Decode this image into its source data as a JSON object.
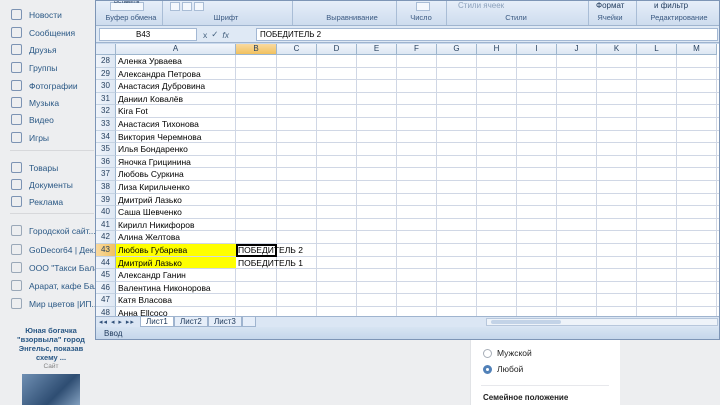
{
  "vk_sidebar": {
    "items": [
      {
        "label": "Новости",
        "icon": "news-icon"
      },
      {
        "label": "Сообщения",
        "icon": "messages-icon"
      },
      {
        "label": "Друзья",
        "icon": "friends-icon"
      },
      {
        "label": "Группы",
        "icon": "groups-icon"
      },
      {
        "label": "Фотографии",
        "icon": "photos-icon"
      },
      {
        "label": "Музыка",
        "icon": "music-icon"
      },
      {
        "label": "Видео",
        "icon": "video-icon"
      },
      {
        "label": "Игры",
        "icon": "games-icon"
      },
      {
        "label": "Товары",
        "icon": "goods-icon"
      },
      {
        "label": "Документы",
        "icon": "documents-icon"
      },
      {
        "label": "Реклама",
        "icon": "ads-icon"
      },
      {
        "label": "Городской сайт...",
        "icon": "group-icon"
      },
      {
        "label": "GoDecor64 | Дек...",
        "icon": "group-icon"
      },
      {
        "label": "ООО \"Такси Бала...",
        "icon": "group-icon"
      },
      {
        "label": "Арарат, кафе Бала...",
        "icon": "group-icon"
      },
      {
        "label": "Мир цветов |ИП...",
        "icon": "group-icon"
      }
    ],
    "ad": {
      "title": "Юная богачка \"взорвыла\" город Энгельс, показав схему ...",
      "subtitle": "Сайт"
    }
  },
  "vk_right": {
    "radio_options": [
      "Мужской",
      "Любой"
    ],
    "selected": "Любой",
    "section_title": "Семейное положение"
  },
  "excel": {
    "ribbon": {
      "top_texts": [
        "Вставить",
        "Формат",
        "и фильтр",
        "Стили ячеек"
      ],
      "groups": [
        "Буфер обмена",
        "Шрифт",
        "Выравнивание",
        "Число",
        "Стили",
        "Ячейки",
        "Редактирование"
      ]
    },
    "name_box": "B43",
    "formula_icons": [
      "x",
      "✓",
      "fx"
    ],
    "formula_value": "ПОБЕДИТЕЛЬ 2",
    "columns": [
      "A",
      "B",
      "C",
      "D",
      "E",
      "F",
      "G",
      "H",
      "I",
      "J",
      "K",
      "L",
      "M"
    ],
    "selected_column": "B",
    "rows": [
      {
        "num": "28",
        "a": "Аленка Урваева",
        "b": "",
        "highlight": false
      },
      {
        "num": "29",
        "a": "Александра Петрова",
        "b": "",
        "highlight": false
      },
      {
        "num": "30",
        "a": "Анастасия Дубровина",
        "b": "",
        "highlight": false
      },
      {
        "num": "31",
        "a": "Даниил Ковалёв",
        "b": "",
        "highlight": false
      },
      {
        "num": "32",
        "a": "Kira Fot",
        "b": "",
        "highlight": false
      },
      {
        "num": "33",
        "a": "Анастасия Тихонова",
        "b": "",
        "highlight": false
      },
      {
        "num": "34",
        "a": "Виктория Черемнова",
        "b": "",
        "highlight": false
      },
      {
        "num": "35",
        "a": "Илья Бондаренко",
        "b": "",
        "highlight": false
      },
      {
        "num": "36",
        "a": "Яночка Грицинина",
        "b": "",
        "highlight": false
      },
      {
        "num": "37",
        "a": "Любовь Суркина",
        "b": "",
        "highlight": false
      },
      {
        "num": "38",
        "a": "Лиза Кирильченко",
        "b": "",
        "highlight": false
      },
      {
        "num": "39",
        "a": "Дмитрий Лазько",
        "b": "",
        "highlight": false
      },
      {
        "num": "40",
        "a": "Саша Шевченко",
        "b": "",
        "highlight": false
      },
      {
        "num": "41",
        "a": "Кирилл Никифоров",
        "b": "",
        "highlight": false
      },
      {
        "num": "42",
        "a": "Алина Желтова",
        "b": "",
        "highlight": false
      },
      {
        "num": "43",
        "a": "Любовь Губарева",
        "b": "ПОБЕДИТЕЛЬ 2",
        "highlight": true
      },
      {
        "num": "44",
        "a": "Дмитрий Лазько",
        "b": "ПОБЕДИТЕЛЬ 1",
        "highlight": true
      },
      {
        "num": "45",
        "a": "Александр Ганин",
        "b": "",
        "highlight": false
      },
      {
        "num": "46",
        "a": "Валентина Никонорова",
        "b": "",
        "highlight": false
      },
      {
        "num": "47",
        "a": "Катя Власова",
        "b": "",
        "highlight": false
      },
      {
        "num": "48",
        "a": "Анна Ellcoco",
        "b": "",
        "highlight": false
      }
    ],
    "selected_row": "43",
    "sheet_tabs": [
      "Лист1",
      "Лист2",
      "Лист3"
    ],
    "active_sheet": "Лист1",
    "status": "Ввод"
  },
  "colors": {
    "highlight": "#ffff00",
    "vk_link": "#2a5885",
    "excel_frame": "#c9d9ed"
  }
}
